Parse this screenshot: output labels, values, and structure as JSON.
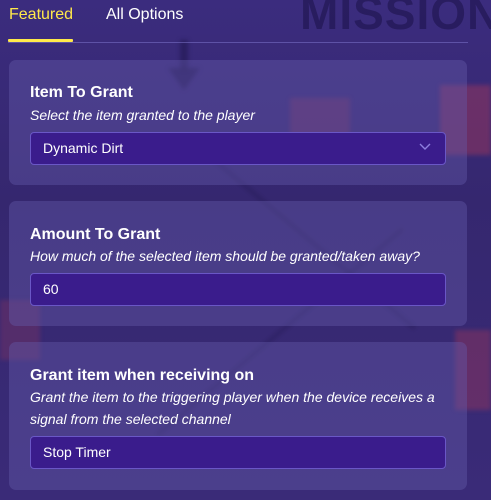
{
  "tabs": [
    {
      "label": "Featured",
      "active": true
    },
    {
      "label": "All Options",
      "active": false
    }
  ],
  "backdrop": {
    "title_fragment": "MISSION"
  },
  "cards": [
    {
      "title": "Item To Grant",
      "description": "Select the item granted to the player",
      "control": "dropdown",
      "value": "Dynamic Dirt",
      "icon": "chevron-down-icon"
    },
    {
      "title": "Amount To Grant",
      "description": "How much of the selected item should be granted/taken away?",
      "control": "number-input",
      "value": "60"
    },
    {
      "title": "Grant item when receiving on",
      "description": "Grant the item to the triggering player when the device receives a signal from the selected channel",
      "control": "text-input",
      "value": "Stop Timer"
    }
  ],
  "colors": {
    "active_tab": "#ffe94a",
    "field_bg": "#3a1c8c",
    "field_border": "#6a57c6",
    "panel_bg": "#3a2a78"
  }
}
